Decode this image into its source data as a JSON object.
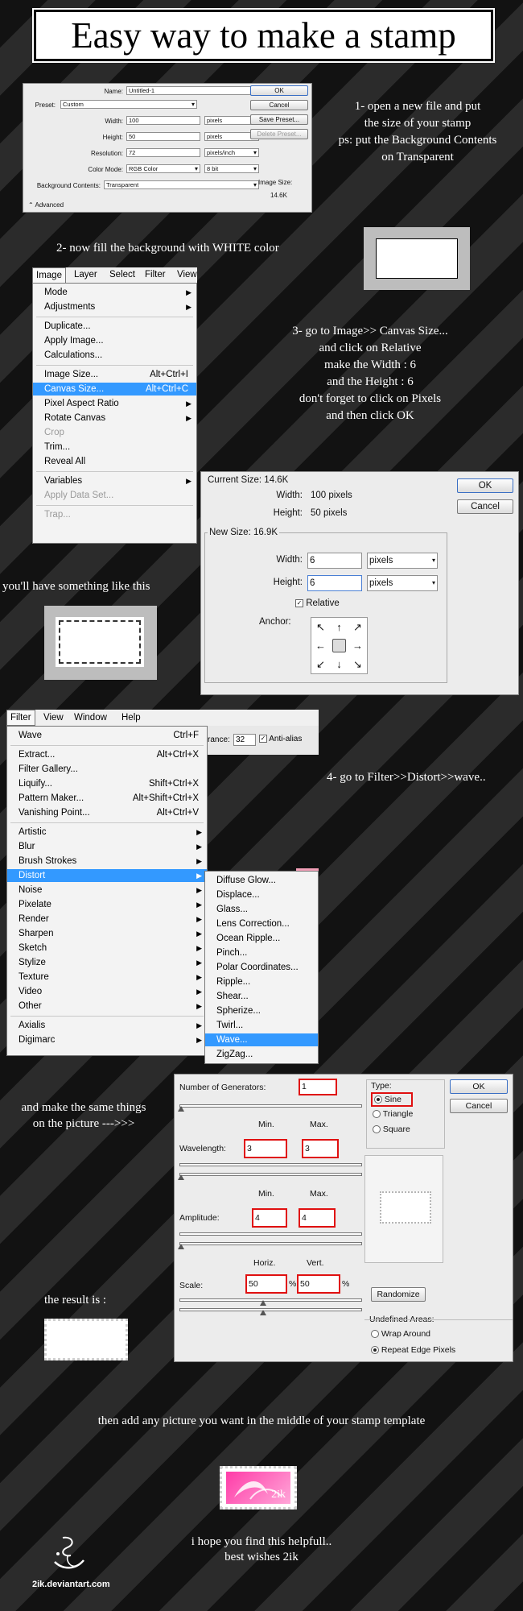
{
  "title": "Easy way to make a stamp",
  "steps": {
    "step1": [
      "1- open a new file and put",
      "the size of your stamp",
      "ps: put the Background Contents",
      "on Transparent"
    ],
    "step2": "2- now fill the background with WHITE color",
    "step3": [
      "3- go to Image>> Canvas Size...",
      "and click on Relative",
      "make the Width : 6",
      "and the Height : 6",
      "don't forget to click on Pixels",
      "and then click OK"
    ],
    "result_like": "you'll have something like this",
    "step4": "4- go to Filter>>Distort>>wave..",
    "same_things": [
      "and make the same things",
      "on the picture --->>>"
    ],
    "result_is": "the result is :",
    "add_picture": "then add any picture you want in the middle of your stamp template",
    "closing": [
      "i hope you find this helpfull..",
      "best wishes 2ik"
    ],
    "signature": "2ik.deviantart.com"
  },
  "new_dialog": {
    "name_label": "Name:",
    "name_value": "Untitled-1",
    "preset_label": "Preset:",
    "preset_value": "Custom",
    "width_label": "Width:",
    "width_value": "100",
    "width_unit": "pixels",
    "height_label": "Height:",
    "height_value": "50",
    "height_unit": "pixels",
    "resolution_label": "Resolution:",
    "resolution_value": "72",
    "resolution_unit": "pixels/inch",
    "color_mode_label": "Color Mode:",
    "color_mode_value": "RGB Color",
    "bit_value": "8 bit",
    "bg_label": "Background Contents:",
    "bg_value": "Transparent",
    "advanced": "Advanced",
    "ok": "OK",
    "cancel": "Cancel",
    "save_preset": "Save Preset...",
    "delete_preset": "Delete Preset...",
    "image_size_label": "Image Size:",
    "image_size_value": "14.6K"
  },
  "image_menu": {
    "bar": [
      "Image",
      "Layer",
      "Select",
      "Filter",
      "View"
    ],
    "items": [
      {
        "label": "Mode",
        "sub": true
      },
      {
        "label": "Adjustments",
        "sub": true
      },
      {
        "label": "Duplicate..."
      },
      {
        "label": "Apply Image..."
      },
      {
        "label": "Calculations..."
      },
      {
        "label": "Image Size...",
        "sc": "Alt+Ctrl+I"
      },
      {
        "label": "Canvas Size...",
        "sc": "Alt+Ctrl+C",
        "hl": true
      },
      {
        "label": "Pixel Aspect Ratio",
        "sub": true
      },
      {
        "label": "Rotate Canvas",
        "sub": true
      },
      {
        "label": "Crop",
        "dis": true
      },
      {
        "label": "Trim..."
      },
      {
        "label": "Reveal All"
      },
      {
        "label": "Variables",
        "sub": true
      },
      {
        "label": "Apply Data Set...",
        "dis": true
      },
      {
        "label": "Trap...",
        "dis": true
      }
    ]
  },
  "canvas_dialog": {
    "current_size": "Current Size: 14.6K",
    "cur_width_label": "Width:",
    "cur_width_value": "100 pixels",
    "cur_height_label": "Height:",
    "cur_height_value": "50 pixels",
    "new_size": "New Size: 16.9K",
    "width_label": "Width:",
    "width_value": "6",
    "width_unit": "pixels",
    "height_label": "Height:",
    "height_value": "6",
    "height_unit": "pixels",
    "relative": "Relative",
    "anchor": "Anchor:",
    "ok": "OK",
    "cancel": "Cancel"
  },
  "filter_menu": {
    "bar": [
      "Filter",
      "View",
      "Window",
      "Help"
    ],
    "options_bar": {
      "tolerance_label": "rance:",
      "tolerance_value": "32",
      "anti_alias": "Anti-alias"
    },
    "items": [
      {
        "label": "Wave",
        "sc": "Ctrl+F"
      },
      {
        "label": "Extract...",
        "sc": "Alt+Ctrl+X"
      },
      {
        "label": "Filter Gallery..."
      },
      {
        "label": "Liquify...",
        "sc": "Shift+Ctrl+X"
      },
      {
        "label": "Pattern Maker...",
        "sc": "Alt+Shift+Ctrl+X"
      },
      {
        "label": "Vanishing Point...",
        "sc": "Alt+Ctrl+V"
      },
      {
        "label": "Artistic",
        "sub": true
      },
      {
        "label": "Blur",
        "sub": true
      },
      {
        "label": "Brush Strokes",
        "sub": true
      },
      {
        "label": "Distort",
        "sub": true,
        "hl": true
      },
      {
        "label": "Noise",
        "sub": true
      },
      {
        "label": "Pixelate",
        "sub": true
      },
      {
        "label": "Render",
        "sub": true
      },
      {
        "label": "Sharpen",
        "sub": true
      },
      {
        "label": "Sketch",
        "sub": true
      },
      {
        "label": "Stylize",
        "sub": true
      },
      {
        "label": "Texture",
        "sub": true
      },
      {
        "label": "Video",
        "sub": true
      },
      {
        "label": "Other",
        "sub": true
      },
      {
        "label": "Axialis",
        "sub": true
      },
      {
        "label": "Digimarc",
        "sub": true
      }
    ],
    "distort_items": [
      {
        "label": "Diffuse Glow..."
      },
      {
        "label": "Displace..."
      },
      {
        "label": "Glass..."
      },
      {
        "label": "Lens Correction..."
      },
      {
        "label": "Ocean Ripple..."
      },
      {
        "label": "Pinch..."
      },
      {
        "label": "Polar Coordinates..."
      },
      {
        "label": "Ripple..."
      },
      {
        "label": "Shear..."
      },
      {
        "label": "Spherize..."
      },
      {
        "label": "Twirl..."
      },
      {
        "label": "Wave...",
        "hl": true
      },
      {
        "label": "ZigZag..."
      }
    ]
  },
  "wave_dialog": {
    "generators_label": "Number of Generators:",
    "generators_value": "1",
    "min": "Min.",
    "max": "Max.",
    "wavelength_label": "Wavelength:",
    "wavelength_min": "3",
    "wavelength_max": "3",
    "amplitude_label": "Amplitude:",
    "amplitude_min": "4",
    "amplitude_max": "4",
    "horiz": "Horiz.",
    "vert": "Vert.",
    "scale_label": "Scale:",
    "scale_h": "50",
    "scale_v": "50",
    "pct": "%",
    "type_label": "Type:",
    "sine": "Sine",
    "triangle": "Triangle",
    "square": "Square",
    "ok": "OK",
    "cancel": "Cancel",
    "randomize": "Randomize",
    "undefined_label": "Undefined Areas:",
    "wrap": "Wrap Around",
    "repeat": "Repeat Edge Pixels"
  },
  "stamp_sample_text": "2ik"
}
